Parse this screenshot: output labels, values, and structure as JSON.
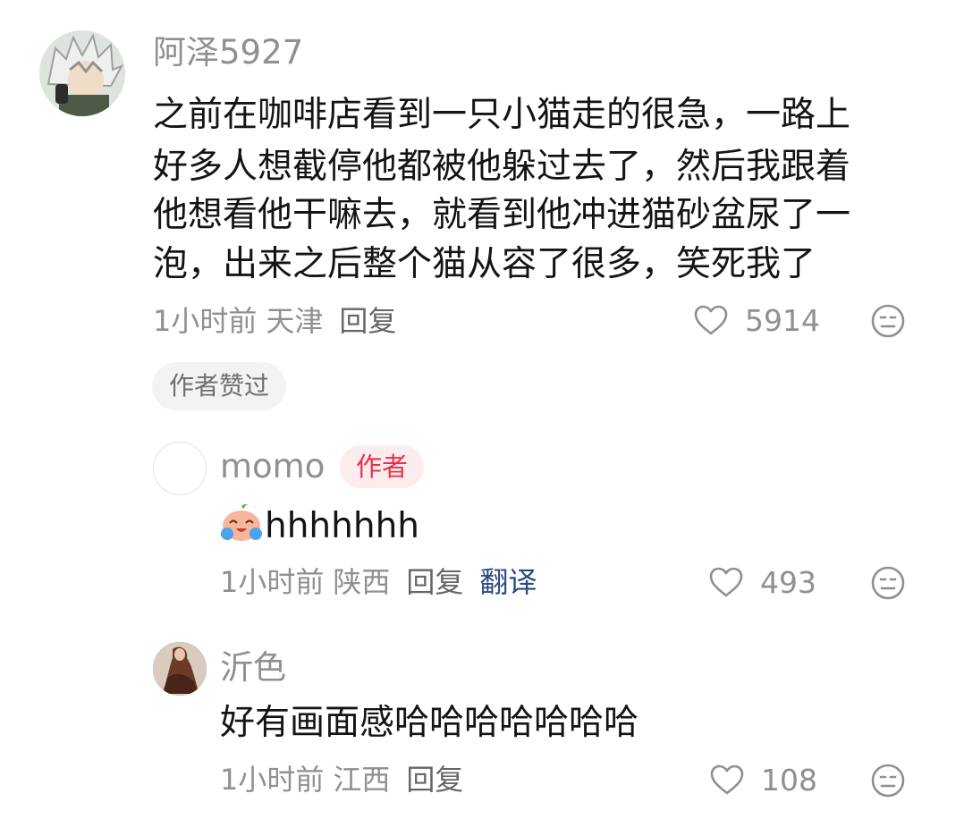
{
  "comments": [
    {
      "username": "阿泽5927",
      "lines": [
        "之前在咖啡店看到一只小猫走的很急，一路上",
        "好多人想截停他都被他躲过去了，然后我跟着",
        "他想看他干嘛去，就看到他冲进猫砂盆尿了一",
        "泡，出来之后整个猫从容了很多，笑死我了"
      ],
      "time": "1小时前",
      "location": "天津",
      "reply_label": "回复",
      "like_count": "5914",
      "badge": "作者赞过"
    }
  ],
  "replies": [
    {
      "username": "momo",
      "author_tag": "作者",
      "emoji": "crying-laughing-emoji",
      "text": "hhhhhhh",
      "time": "1小时前",
      "location": "陕西",
      "reply_label": "回复",
      "translate_label": "翻译",
      "like_count": "493"
    },
    {
      "username": "沂色",
      "text": "好有画面感哈哈哈哈哈哈哈",
      "time": "1小时前",
      "location": "江西",
      "reply_label": "回复",
      "like_count": "108"
    }
  ],
  "colors": {
    "text_primary": "#141414",
    "text_secondary": "#8f8f94",
    "author_tag": "#e3334a",
    "translate_link": "#2c4a80"
  }
}
